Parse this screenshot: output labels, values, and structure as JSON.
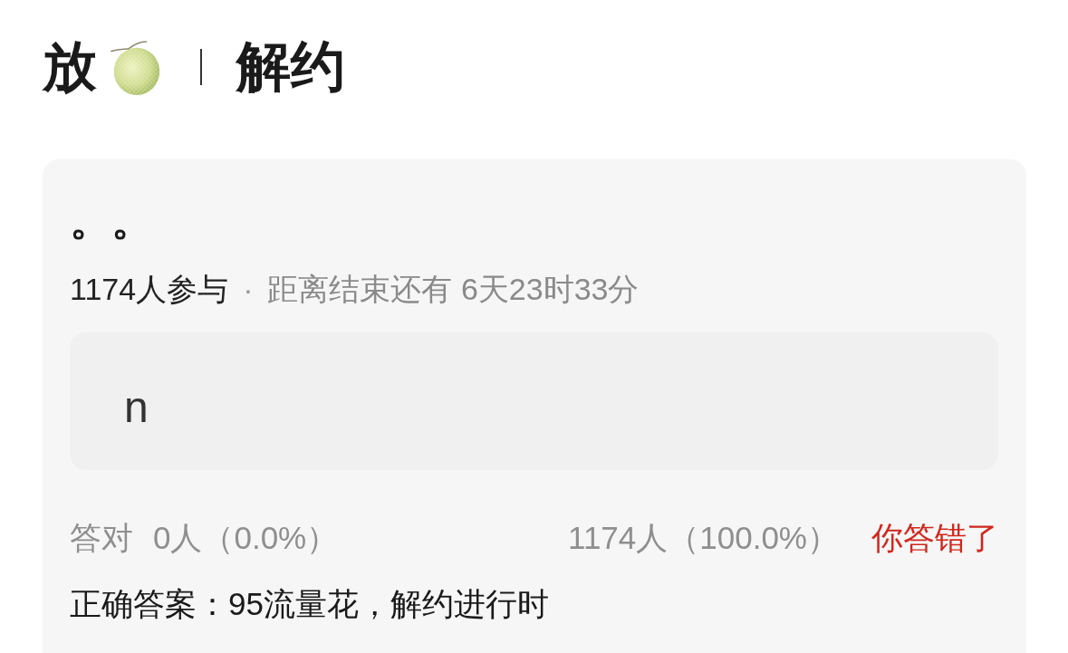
{
  "header": {
    "title_start": "放",
    "title_end": "解约"
  },
  "quiz": {
    "question": "。。",
    "participants": "1174人参与",
    "separator": "·",
    "countdown": "距离结束还有 6天23时33分",
    "options": [
      {
        "text": "n"
      }
    ],
    "results": {
      "correct_label": "答对",
      "correct_count": "0人（0.0%）",
      "wrong_count": "1174人（100.0%）",
      "verdict": {
        "text": "你答错了",
        "correct": false
      }
    },
    "correct_answer": "正确答案：95流量花，解约进行时"
  }
}
